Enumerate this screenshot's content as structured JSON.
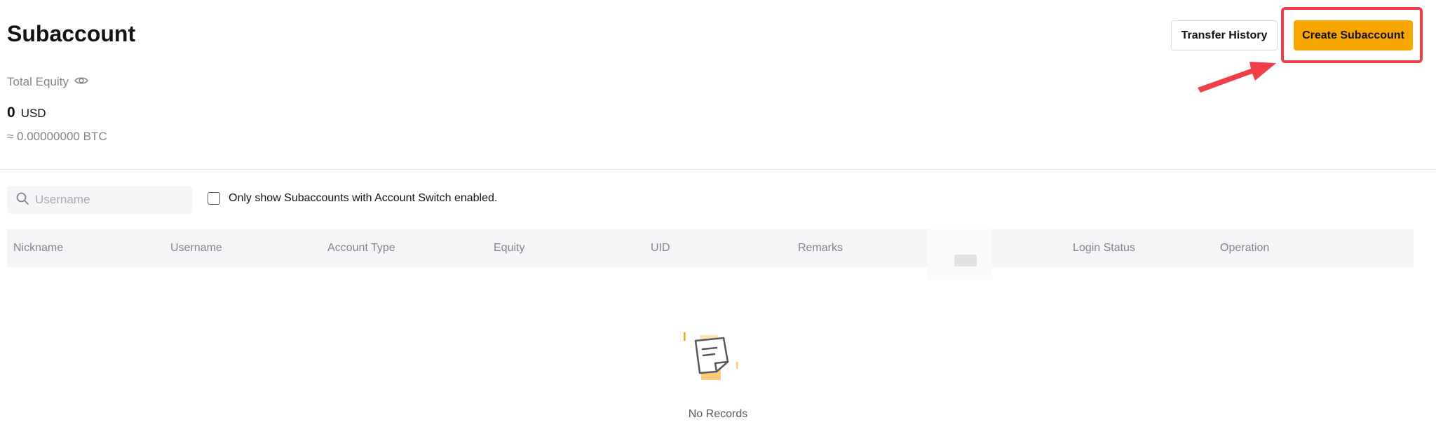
{
  "page": {
    "title": "Subaccount",
    "transfer_history_label": "Transfer History",
    "create_subaccount_label": "Create Subaccount"
  },
  "equity": {
    "label": "Total Equity",
    "value": "0",
    "currency": "USD",
    "btc_approx": "≈ 0.00000000 BTC"
  },
  "filters": {
    "search_placeholder": "Username",
    "search_value": "",
    "account_switch_label": "Only show Subaccounts with Account Switch enabled."
  },
  "table": {
    "columns": [
      "Nickname",
      "Username",
      "Account Type",
      "Equity",
      "UID",
      "Remarks",
      "Login Status",
      "Operation"
    ]
  },
  "empty_state": {
    "text": "No Records"
  },
  "colors": {
    "accent": "#f7a600",
    "highlight": "#ef3e48",
    "muted_text": "#81858c"
  },
  "icons": {
    "equity_visibility": "eye-icon",
    "search": "search-icon",
    "empty": "empty-records-icon",
    "annotation": "red-arrow-icon"
  }
}
